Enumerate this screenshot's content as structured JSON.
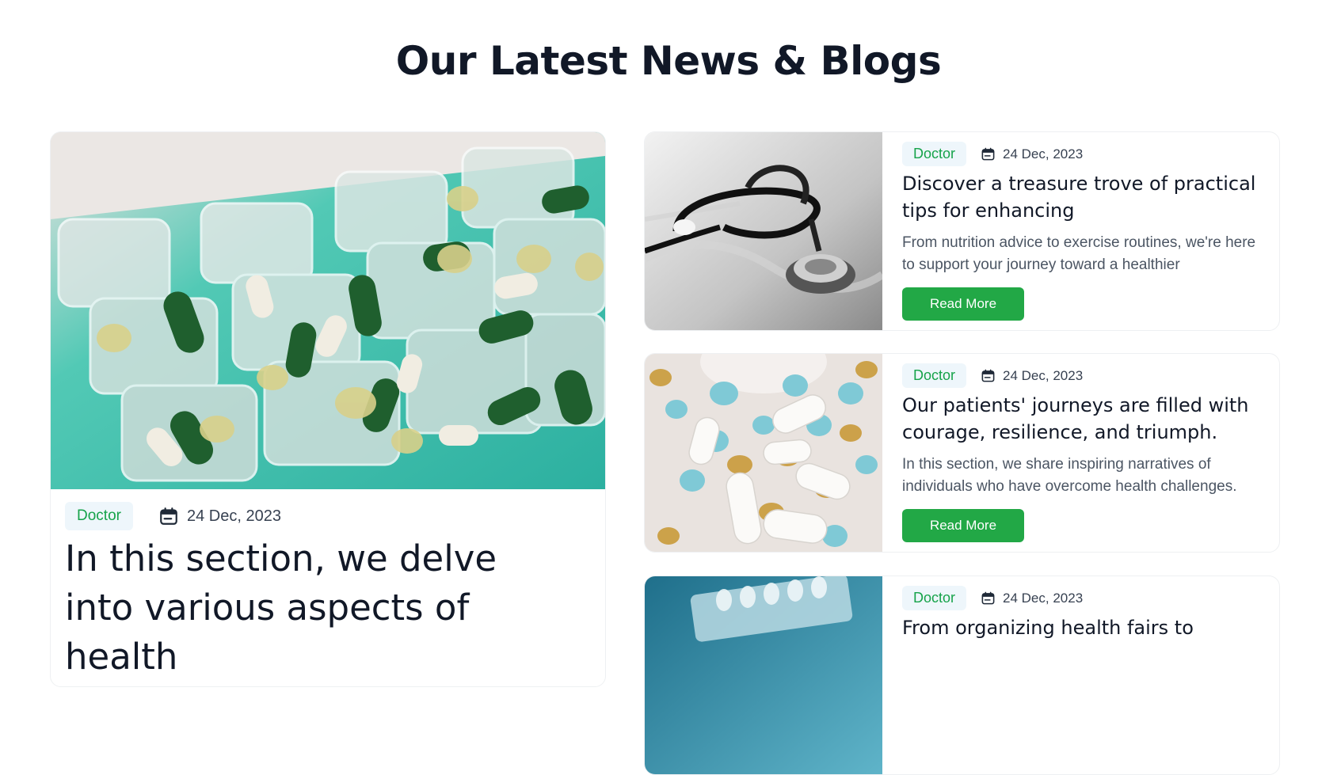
{
  "section": {
    "title": "Our Latest News & Blogs"
  },
  "colors": {
    "accent": "#22a846",
    "badge_bg": "#eef6fb",
    "badge_text": "#16a34a",
    "heading": "#111827",
    "body_text": "#4b5563"
  },
  "featured": {
    "category": "Doctor",
    "date": "24 Dec, 2023",
    "title": "In this section, we delve into various aspects of health",
    "image": "pill-organizer-photo",
    "date_icon": "calendar-icon"
  },
  "posts": [
    {
      "category": "Doctor",
      "date": "24 Dec, 2023",
      "title": "Discover a treasure trove of practical tips for enhancing",
      "excerpt": "From nutrition advice to exercise routines, we're here to support your journey toward a healthier",
      "cta": "Read More",
      "image": "stethoscope-photo",
      "date_icon": "calendar-icon"
    },
    {
      "category": "Doctor",
      "date": "24 Dec, 2023",
      "title": "Our patients' journeys are filled with courage, resilience, and triumph.",
      "excerpt": "In this section, we share inspiring narratives of individuals who have overcome health challenges.",
      "cta": "Read More",
      "image": "scattered-pills-photo",
      "date_icon": "calendar-icon"
    },
    {
      "category": "Doctor",
      "date": "24 Dec, 2023",
      "title": "From organizing health fairs to",
      "image": "blister-pack-photo",
      "date_icon": "calendar-icon"
    }
  ]
}
